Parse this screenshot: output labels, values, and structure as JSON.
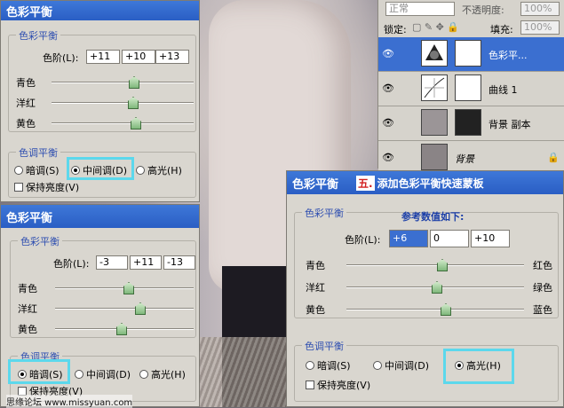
{
  "top_dialog": {
    "title": "色彩平衡",
    "group_balance": "色彩平衡",
    "levels_label": "色阶(L):",
    "levels": [
      "+11",
      "+10",
      "+13"
    ],
    "sliders": [
      "青色",
      "洋红",
      "黄色"
    ],
    "group_tone": "色调平衡",
    "tones": [
      "暗调(S)",
      "中间调(D)",
      "高光(H)"
    ],
    "preserve": "保持亮度(V)"
  },
  "mid_dialog": {
    "title": "色彩平衡",
    "group_balance": "色彩平衡",
    "levels_label": "色阶(L):",
    "levels": [
      "-3",
      "+11",
      "-13"
    ],
    "sliders": [
      "青色",
      "洋红",
      "黄色"
    ],
    "group_tone": "色调平衡",
    "tones": [
      "暗调(S)",
      "中间调(D)",
      "高光(H)"
    ],
    "preserve": "保持亮度(V)"
  },
  "right_dialog": {
    "title": "色彩平衡",
    "step_badge": "五.",
    "step_text": "添加色彩平衡快速蒙板",
    "group_balance": "色彩平衡",
    "reference_note": "参考数值如下:",
    "levels_label": "色阶(L):",
    "levels": [
      "+6",
      "0",
      "+10"
    ],
    "sliders_left": [
      "青色",
      "洋红",
      "黄色"
    ],
    "sliders_right": [
      "红色",
      "绿色",
      "蓝色"
    ],
    "group_tone": "色调平衡",
    "tones": [
      "暗调(S)",
      "中间调(D)",
      "高光(H)"
    ],
    "preserve": "保持亮度(V)"
  },
  "layers_panel": {
    "blend_mode": "正常",
    "opacity_label": "不透明度:",
    "opacity_value": "100%",
    "lock_label": "锁定:",
    "fill_label": "填充:",
    "fill_value": "100%",
    "layers": [
      "色彩平...",
      "曲线 1",
      "背景 副本",
      "背景"
    ]
  },
  "watermark": "思缘论坛 www.missyuan.com",
  "colors": {
    "title_blue": "#2a5ec4",
    "highlight": "#5cd8ec",
    "badge_red": "#d21f1f"
  }
}
